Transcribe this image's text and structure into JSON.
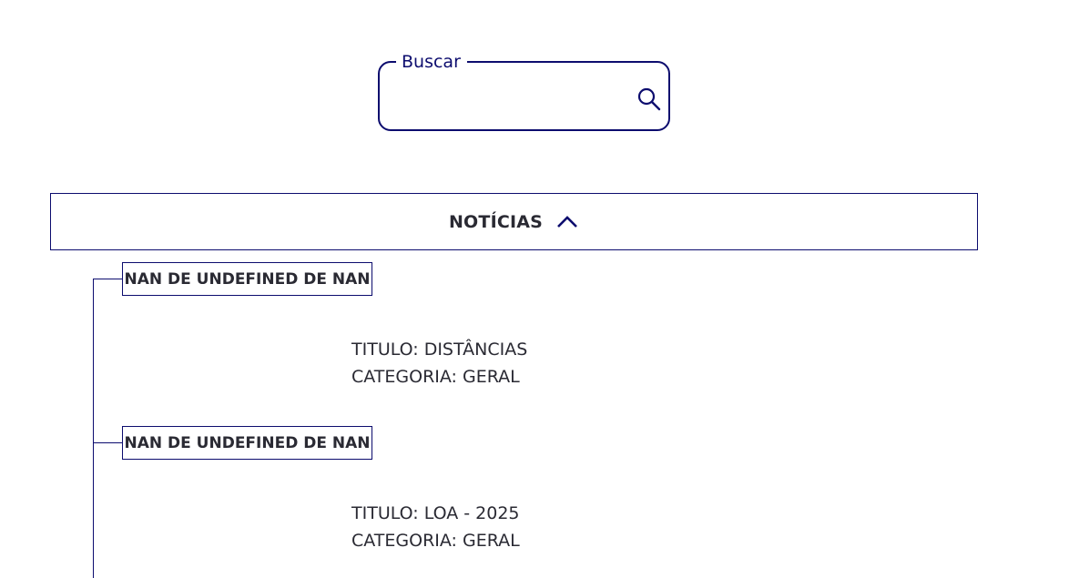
{
  "search": {
    "label": "Buscar",
    "value": "",
    "placeholder": "",
    "icon": "search-icon"
  },
  "accordion": {
    "title": "NOTÍCIAS",
    "icon": "chevron-up-icon",
    "expanded": true
  },
  "items": [
    {
      "date": "NAN DE UNDEFINED DE NAN",
      "titulo_prefix": "TITULO:",
      "titulo": "DISTÂNCIAS",
      "categoria_prefix": "CATEGORIA:",
      "categoria": "GERAL"
    },
    {
      "date": "NAN DE UNDEFINED DE NAN",
      "titulo_prefix": "TITULO:",
      "titulo": "LOA - 2025",
      "categoria_prefix": "CATEGORIA:",
      "categoria": "GERAL"
    }
  ],
  "colors": {
    "accent": "#0c0c6e",
    "text": "#2a2a33",
    "background": "#ffffff"
  }
}
